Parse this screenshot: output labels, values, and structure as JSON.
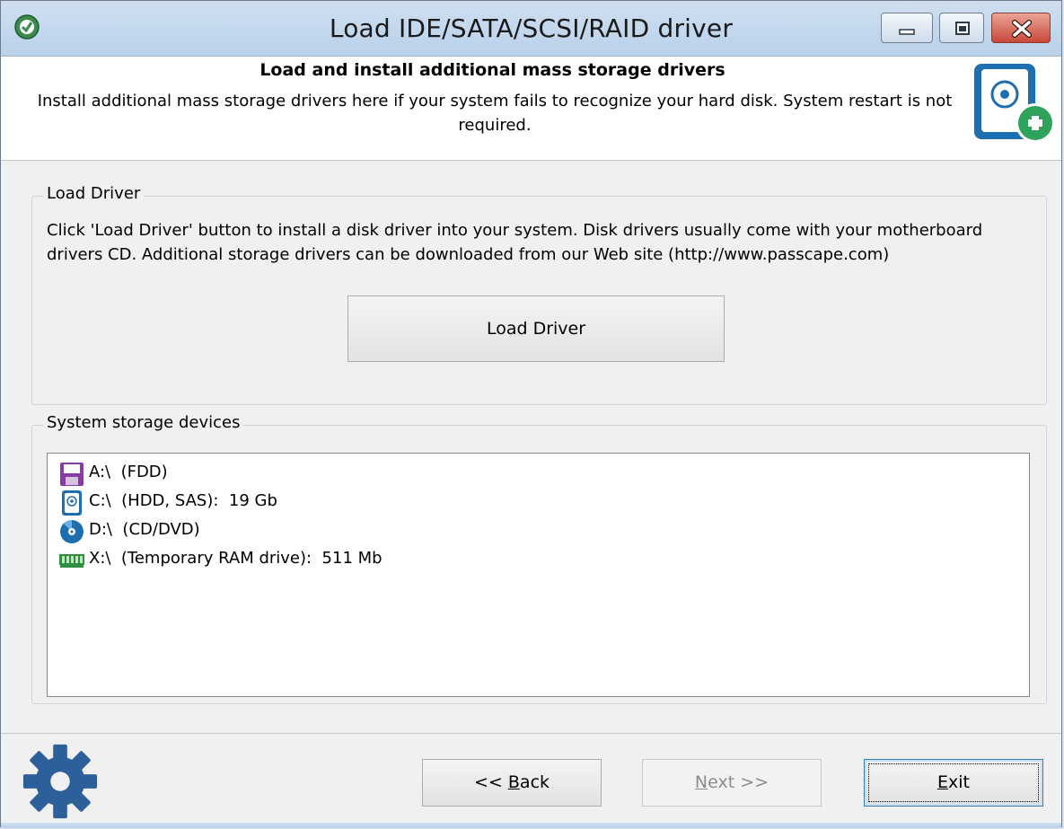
{
  "window": {
    "title": "Load IDE/SATA/SCSI/RAID driver",
    "icons": {
      "app": "app-shield-icon",
      "minimize": "minimize-icon",
      "maximize": "maximize-icon",
      "close": "close-icon"
    }
  },
  "header": {
    "title": "Load and install additional mass storage drivers",
    "description": "Install additional mass storage drivers here if your system fails to recognize your hard disk. System restart is not required.",
    "icon": "hard-disk-add-icon"
  },
  "load_driver_group": {
    "legend": "Load Driver",
    "description": "Click 'Load Driver' button to install a disk driver into your system. Disk drivers usually come with your motherboard drivers CD. Additional storage drivers can be downloaded from our Web site (http://www.passcape.com)",
    "button_label": "Load Driver"
  },
  "storage_group": {
    "legend": "System storage devices",
    "devices": [
      {
        "label": "A:\\  (FDD)",
        "icon": "floppy-icon"
      },
      {
        "label": "C:\\  (HDD, SAS):  19 Gb",
        "icon": "hard-disk-icon"
      },
      {
        "label": "D:\\  (CD/DVD)",
        "icon": "cd-dvd-icon"
      },
      {
        "label": "X:\\  (Temporary RAM drive):  511 Mb",
        "icon": "ram-icon"
      }
    ]
  },
  "footer": {
    "back_prefix": "<< ",
    "back_accel": "B",
    "back_rest": "ack",
    "next_accel": "N",
    "next_rest": "ext >>",
    "exit_accel": "E",
    "exit_rest": "xit",
    "icon": "settings-gear-icon"
  },
  "colors": {
    "titlebar": "#b9d1ea",
    "accent_blue": "#1e6fb0",
    "plus_green": "#2fa35b",
    "close_red": "#c9483a"
  }
}
